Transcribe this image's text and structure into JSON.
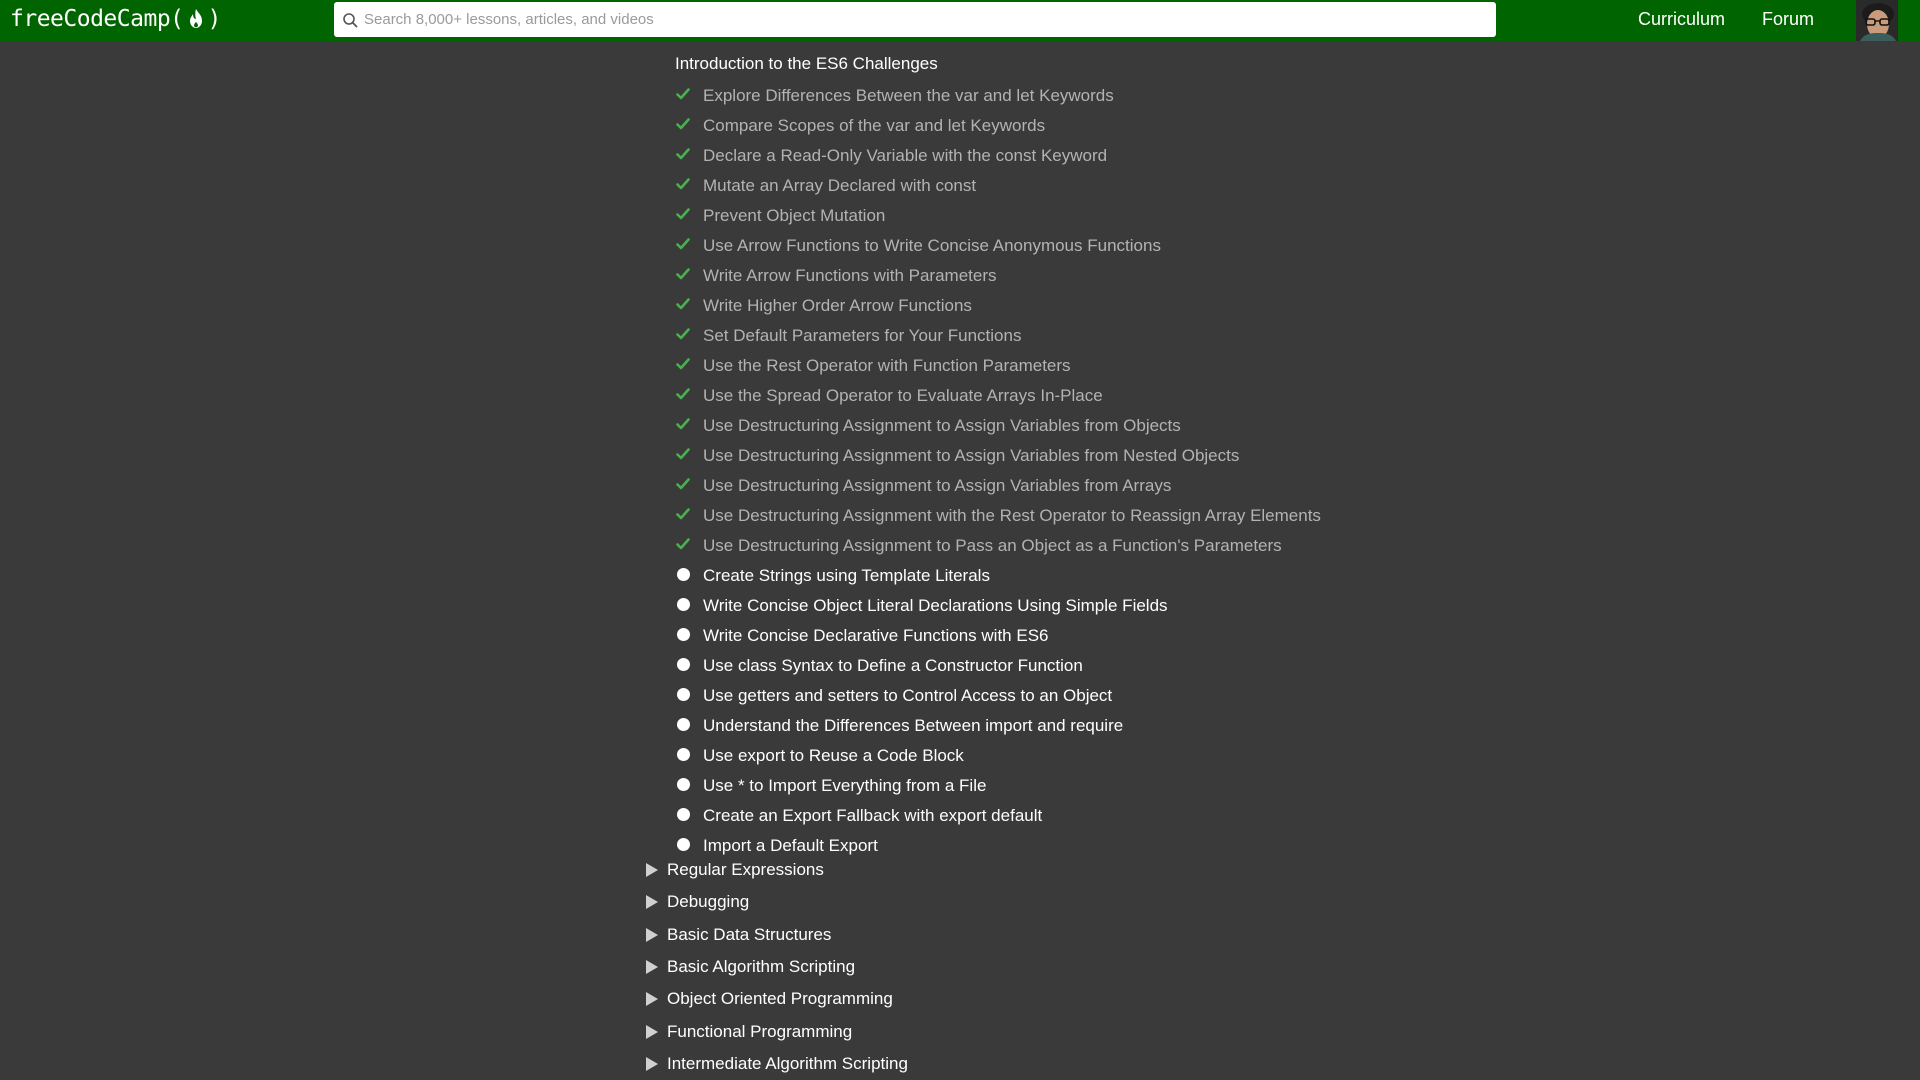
{
  "navbar": {
    "logo_text_a": "freeCodeCamp(",
    "logo_text_b": ")",
    "search_placeholder": "Search 8,000+ lessons, articles, and videos",
    "links": [
      "Curriculum",
      "Forum"
    ]
  },
  "colors": {
    "navbar_bg": "#006400",
    "page_bg": "#3a3a3a",
    "check": "#4caf50",
    "completed_text": "#b3b3b3"
  },
  "block": {
    "title": "Introduction to the ES6 Challenges",
    "challenges": [
      {
        "label": "Explore Differences Between the var and let Keywords",
        "completed": true
      },
      {
        "label": "Compare Scopes of the var and let Keywords",
        "completed": true
      },
      {
        "label": "Declare a Read-Only Variable with the const Keyword",
        "completed": true
      },
      {
        "label": "Mutate an Array Declared with const",
        "completed": true
      },
      {
        "label": "Prevent Object Mutation",
        "completed": true
      },
      {
        "label": "Use Arrow Functions to Write Concise Anonymous Functions",
        "completed": true
      },
      {
        "label": "Write Arrow Functions with Parameters",
        "completed": true
      },
      {
        "label": "Write Higher Order Arrow Functions",
        "completed": true
      },
      {
        "label": "Set Default Parameters for Your Functions",
        "completed": true
      },
      {
        "label": "Use the Rest Operator with Function Parameters",
        "completed": true
      },
      {
        "label": "Use the Spread Operator to Evaluate Arrays In-Place",
        "completed": true
      },
      {
        "label": "Use Destructuring Assignment to Assign Variables from Objects",
        "completed": true
      },
      {
        "label": "Use Destructuring Assignment to Assign Variables from Nested Objects",
        "completed": true
      },
      {
        "label": "Use Destructuring Assignment to Assign Variables from Arrays",
        "completed": true
      },
      {
        "label": "Use Destructuring Assignment with the Rest Operator to Reassign Array Elements",
        "completed": true
      },
      {
        "label": "Use Destructuring Assignment to Pass an Object as a Function's Parameters",
        "completed": true
      },
      {
        "label": "Create Strings using Template Literals",
        "completed": false
      },
      {
        "label": "Write Concise Object Literal Declarations Using Simple Fields",
        "completed": false
      },
      {
        "label": "Write Concise Declarative Functions with ES6",
        "completed": false
      },
      {
        "label": "Use class Syntax to Define a Constructor Function",
        "completed": false
      },
      {
        "label": "Use getters and setters to Control Access to an Object",
        "completed": false
      },
      {
        "label": "Understand the Differences Between import and require",
        "completed": false
      },
      {
        "label": "Use export to Reuse a Code Block",
        "completed": false
      },
      {
        "label": "Use * to Import Everything from a File",
        "completed": false
      },
      {
        "label": "Create an Export Fallback with export default",
        "completed": false
      },
      {
        "label": "Import a Default Export",
        "completed": false
      }
    ]
  },
  "sections": [
    "Regular Expressions",
    "Debugging",
    "Basic Data Structures",
    "Basic Algorithm Scripting",
    "Object Oriented Programming",
    "Functional Programming",
    "Intermediate Algorithm Scripting"
  ]
}
